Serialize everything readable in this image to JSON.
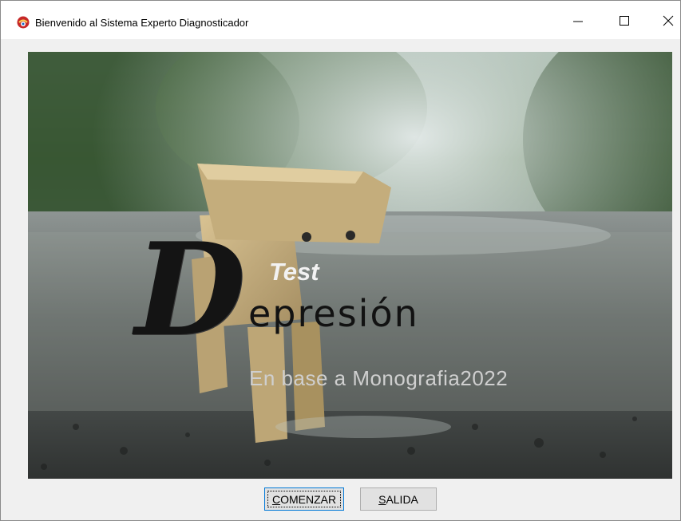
{
  "window": {
    "title": "Bienvenido al Sistema Experto Diagnosticador",
    "minimize_glyph": "minimize-icon",
    "maximize_glyph": "maximize-icon",
    "close_glyph": "close-icon"
  },
  "hero": {
    "test_label": "Test",
    "title_initial": "D",
    "title_rest": "epresión",
    "subtitle": "En base a Monografia2022"
  },
  "buttons": {
    "start": {
      "mnemonic": "C",
      "rest": "OMENZAR"
    },
    "exit": {
      "mnemonic": "S",
      "rest": "ALIDA"
    }
  },
  "colors": {
    "accent_focus": "#0078d7",
    "button_face": "#e1e1e1",
    "window_bg": "#f0f0f0"
  }
}
